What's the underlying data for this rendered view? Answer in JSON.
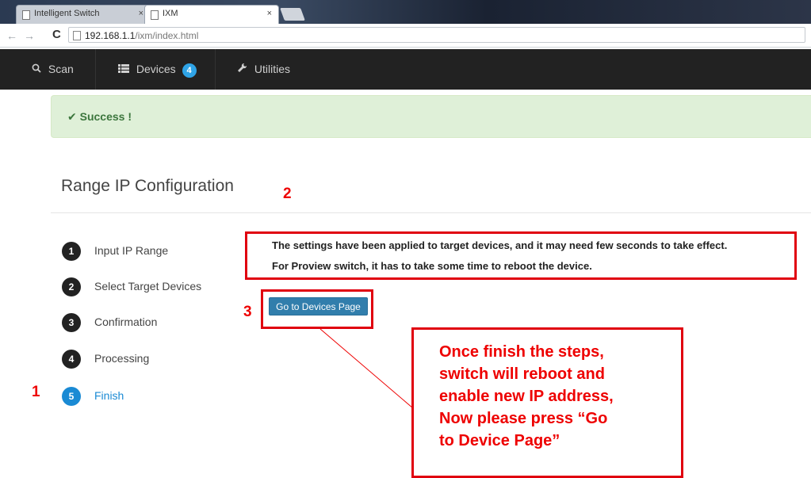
{
  "browser": {
    "tabs": [
      {
        "label": "Intelligent Switch",
        "close": "×"
      },
      {
        "label": "IXM",
        "close": "×"
      }
    ],
    "url_host": "192.168.1.1",
    "url_path": "/ixm/index.html"
  },
  "navbar": {
    "scan": "Scan",
    "devices": "Devices",
    "devices_count": "4",
    "utilities": "Utilities"
  },
  "alert": {
    "message": "Success !"
  },
  "page": {
    "title": "Range IP Configuration"
  },
  "steps": [
    {
      "num": "1",
      "label": "Input IP Range"
    },
    {
      "num": "2",
      "label": "Select Target Devices"
    },
    {
      "num": "3",
      "label": "Confirmation"
    },
    {
      "num": "4",
      "label": "Processing"
    },
    {
      "num": "5",
      "label": "Finish",
      "active": true
    }
  ],
  "result": {
    "line1": "The settings have been applied to target devices, and it may need few seconds to take effect.",
    "line2": "For Proview switch, it has to take some time to reboot the device."
  },
  "go_button": "Go to Devices Page",
  "annotations": {
    "n1": "1",
    "n2": "2",
    "n3": "3",
    "callout": "Once finish the steps,\nswitch  will reboot and\nenable new IP address,\nNow please press “Go\nto Device Page”"
  },
  "colors": {
    "annotation_red": "#e00000",
    "navbar_bg": "#222222",
    "primary_button": "#317eac",
    "active_step": "#1a8ad4",
    "success_bg": "#dff0d8"
  }
}
